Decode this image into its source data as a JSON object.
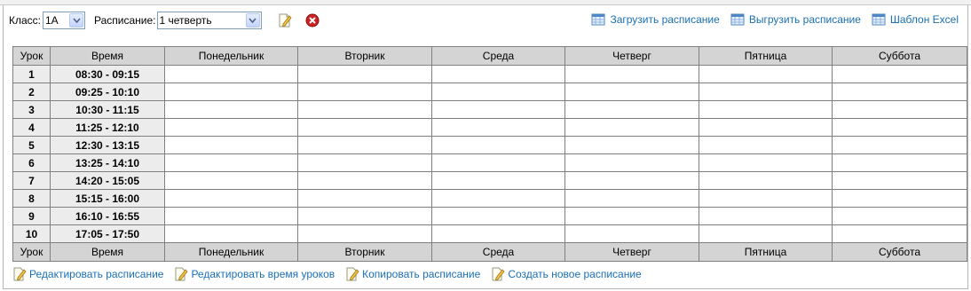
{
  "toolbar": {
    "class_label": "Класс:",
    "class_value": "1А",
    "schedule_label": "Расписание:",
    "schedule_value": "1 четверть"
  },
  "top_links": [
    {
      "label": "Загрузить расписание",
      "icon": "table-icon"
    },
    {
      "label": "Выгрузить расписание",
      "icon": "table-icon"
    },
    {
      "label": "Шаблон Excel",
      "icon": "table-icon"
    }
  ],
  "table": {
    "headers": [
      "Урок",
      "Время",
      "Понедельник",
      "Вторник",
      "Среда",
      "Четверг",
      "Пятница",
      "Суббота"
    ],
    "rows": [
      {
        "num": "1",
        "time": "08:30 - 09:15"
      },
      {
        "num": "2",
        "time": "09:25 - 10:10"
      },
      {
        "num": "3",
        "time": "10:30 - 11:15"
      },
      {
        "num": "4",
        "time": "11:25 - 12:10"
      },
      {
        "num": "5",
        "time": "12:30 - 13:15"
      },
      {
        "num": "6",
        "time": "13:25 - 14:10"
      },
      {
        "num": "7",
        "time": "14:20 - 15:05"
      },
      {
        "num": "8",
        "time": "15:15 - 16:00"
      },
      {
        "num": "9",
        "time": "16:10 - 16:55"
      },
      {
        "num": "10",
        "time": "17:05 - 17:50"
      }
    ]
  },
  "bottom_links": [
    {
      "label": "Редактировать расписание",
      "icon": "edit-document-icon"
    },
    {
      "label": "Редактировать время уроков",
      "icon": "edit-document-icon"
    },
    {
      "label": "Копировать расписание",
      "icon": "edit-document-icon"
    },
    {
      "label": "Создать новое расписание",
      "icon": "edit-document-icon"
    }
  ],
  "colors": {
    "link": "#1a6fb5",
    "header_bg": "#d4d4d4",
    "first_cols_bg": "#ececec",
    "delete_icon": "#cc2222"
  }
}
